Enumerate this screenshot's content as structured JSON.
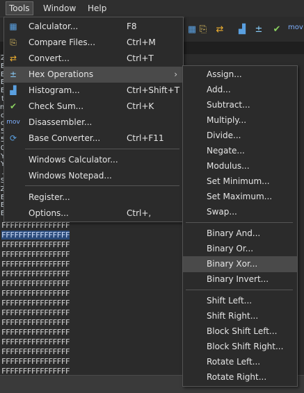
{
  "menubar": {
    "tools": "Tools",
    "window": "Window",
    "help": "Help"
  },
  "toolbar": {
    "mov": "mov"
  },
  "gutter": [
    "2",
    "E",
    "E",
    "E",
    "E",
    "t",
    "m",
    "o",
    "o",
    "5",
    "5",
    "0",
    "Y",
    "Y",
    ".",
    "S",
    "Z",
    "E",
    "E",
    "E"
  ],
  "hex_rows": [
    "FFFFFFFFFFFFFFFF",
    "FFFFFFFFFFFFFFFF",
    "FFFFFFFFFFFFFFFF",
    "FFFFFFFFFFFFFFFF",
    "FFFFFFFFFFFFFFFF",
    "FFFFFFFFFFFFFFFF",
    "FFFFFFFFFFFFFFFF",
    "FFFFFFFFFFFFFFFF",
    "FFFFFFFFFFFFFFFF",
    "FFFFFFFFFFFFFFFF",
    "FFFFFFFFFFFFFFFF",
    "FFFFFFFFFFFFFFFF",
    "FFFFFFFFFFFFFFFF",
    "FFFFFFFFFFFFFFFF",
    "FFFFFFFFFFFFFFFF",
    "FFFFFFFFFFFFFFFF"
  ],
  "tools_menu": {
    "items": [
      {
        "label": "Calculator...",
        "shortcut": "F8",
        "icon": "calculator-icon"
      },
      {
        "label": "Compare Files...",
        "shortcut": "Ctrl+M",
        "icon": "compare-files-icon"
      },
      {
        "label": "Convert...",
        "shortcut": "Ctrl+T",
        "icon": "convert-icon"
      },
      {
        "label": "Hex Operations",
        "shortcut": "",
        "icon": "hex-operations-icon"
      },
      {
        "label": "Histogram...",
        "shortcut": "Ctrl+Shift+T",
        "icon": "histogram-icon"
      },
      {
        "label": "Check Sum...",
        "shortcut": "Ctrl+K",
        "icon": "checksum-icon"
      },
      {
        "label": "Disassembler...",
        "shortcut": "",
        "icon": "disassembler-icon"
      },
      {
        "label": "Base Converter...",
        "shortcut": "Ctrl+F11",
        "icon": "base-converter-icon"
      },
      {
        "label": "Windows Calculator...",
        "shortcut": ""
      },
      {
        "label": "Windows Notepad...",
        "shortcut": ""
      },
      {
        "label": "Register...",
        "shortcut": ""
      },
      {
        "label": "Options...",
        "shortcut": "Ctrl+,"
      }
    ],
    "disassembler_icon_text": "mov",
    "base_icon_text": "10/16"
  },
  "hex_menu": {
    "items": [
      "Assign...",
      "Add...",
      "Subtract...",
      "Multiply...",
      "Divide...",
      "Negate...",
      "Modulus...",
      "Set Minimum...",
      "Set Maximum...",
      "Swap...",
      "Binary And...",
      "Binary Or...",
      "Binary Xor...",
      "Binary Invert...",
      "Shift Left...",
      "Shift Right...",
      "Block Shift Left...",
      "Block Shift Right...",
      "Rotate Left...",
      "Rotate Right..."
    ]
  }
}
